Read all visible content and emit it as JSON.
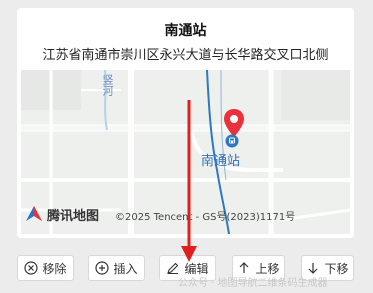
{
  "card": {
    "title": "南通站",
    "address": "江苏省南通市崇川区永兴大道与长华路交叉口北侧"
  },
  "map": {
    "station_label": "南通站",
    "river_label": "竖河",
    "logo_text": "腾讯地图",
    "copyright": "©2025 Tencent - GS号(2023)1171号",
    "marker_color": "#e8323c",
    "rail_color": "#2e78c2"
  },
  "toolbar": {
    "remove_label": "移除",
    "insert_label": "插入",
    "edit_label": "编辑",
    "up_label": "上移",
    "down_label": "下移"
  },
  "watermark": "公众号 · 地图导航二维条码生成器",
  "annotation": {
    "arrow_color": "#e02020"
  }
}
